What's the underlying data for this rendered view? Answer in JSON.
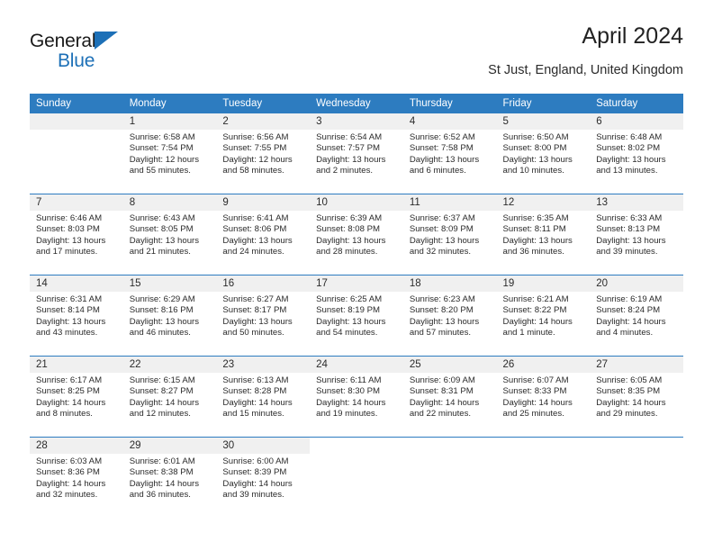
{
  "brand": {
    "name_part1": "General",
    "name_part2": "Blue",
    "triangle_color": "#1d70b7"
  },
  "header": {
    "title": "April 2024",
    "subtitle": "St Just, England, United Kingdom",
    "header_bg": "#2d7cc0",
    "daynum_bg": "#f0f0f0"
  },
  "weekdays": [
    "Sunday",
    "Monday",
    "Tuesday",
    "Wednesday",
    "Thursday",
    "Friday",
    "Saturday"
  ],
  "labels": {
    "sunrise_prefix": "Sunrise:",
    "sunset_prefix": "Sunset:",
    "daylight_prefix": "Daylight:"
  },
  "weeks": [
    [
      {
        "day": "",
        "l1": "",
        "l2": "",
        "l3": "",
        "l4": "",
        "empty": true
      },
      {
        "day": "1",
        "l1": "Sunrise: 6:58 AM",
        "l2": "Sunset: 7:54 PM",
        "l3": "Daylight: 12 hours",
        "l4": "and 55 minutes."
      },
      {
        "day": "2",
        "l1": "Sunrise: 6:56 AM",
        "l2": "Sunset: 7:55 PM",
        "l3": "Daylight: 12 hours",
        "l4": "and 58 minutes."
      },
      {
        "day": "3",
        "l1": "Sunrise: 6:54 AM",
        "l2": "Sunset: 7:57 PM",
        "l3": "Daylight: 13 hours",
        "l4": "and 2 minutes."
      },
      {
        "day": "4",
        "l1": "Sunrise: 6:52 AM",
        "l2": "Sunset: 7:58 PM",
        "l3": "Daylight: 13 hours",
        "l4": "and 6 minutes."
      },
      {
        "day": "5",
        "l1": "Sunrise: 6:50 AM",
        "l2": "Sunset: 8:00 PM",
        "l3": "Daylight: 13 hours",
        "l4": "and 10 minutes."
      },
      {
        "day": "6",
        "l1": "Sunrise: 6:48 AM",
        "l2": "Sunset: 8:02 PM",
        "l3": "Daylight: 13 hours",
        "l4": "and 13 minutes."
      }
    ],
    [
      {
        "day": "7",
        "l1": "Sunrise: 6:46 AM",
        "l2": "Sunset: 8:03 PM",
        "l3": "Daylight: 13 hours",
        "l4": "and 17 minutes."
      },
      {
        "day": "8",
        "l1": "Sunrise: 6:43 AM",
        "l2": "Sunset: 8:05 PM",
        "l3": "Daylight: 13 hours",
        "l4": "and 21 minutes."
      },
      {
        "day": "9",
        "l1": "Sunrise: 6:41 AM",
        "l2": "Sunset: 8:06 PM",
        "l3": "Daylight: 13 hours",
        "l4": "and 24 minutes."
      },
      {
        "day": "10",
        "l1": "Sunrise: 6:39 AM",
        "l2": "Sunset: 8:08 PM",
        "l3": "Daylight: 13 hours",
        "l4": "and 28 minutes."
      },
      {
        "day": "11",
        "l1": "Sunrise: 6:37 AM",
        "l2": "Sunset: 8:09 PM",
        "l3": "Daylight: 13 hours",
        "l4": "and 32 minutes."
      },
      {
        "day": "12",
        "l1": "Sunrise: 6:35 AM",
        "l2": "Sunset: 8:11 PM",
        "l3": "Daylight: 13 hours",
        "l4": "and 36 minutes."
      },
      {
        "day": "13",
        "l1": "Sunrise: 6:33 AM",
        "l2": "Sunset: 8:13 PM",
        "l3": "Daylight: 13 hours",
        "l4": "and 39 minutes."
      }
    ],
    [
      {
        "day": "14",
        "l1": "Sunrise: 6:31 AM",
        "l2": "Sunset: 8:14 PM",
        "l3": "Daylight: 13 hours",
        "l4": "and 43 minutes."
      },
      {
        "day": "15",
        "l1": "Sunrise: 6:29 AM",
        "l2": "Sunset: 8:16 PM",
        "l3": "Daylight: 13 hours",
        "l4": "and 46 minutes."
      },
      {
        "day": "16",
        "l1": "Sunrise: 6:27 AM",
        "l2": "Sunset: 8:17 PM",
        "l3": "Daylight: 13 hours",
        "l4": "and 50 minutes."
      },
      {
        "day": "17",
        "l1": "Sunrise: 6:25 AM",
        "l2": "Sunset: 8:19 PM",
        "l3": "Daylight: 13 hours",
        "l4": "and 54 minutes."
      },
      {
        "day": "18",
        "l1": "Sunrise: 6:23 AM",
        "l2": "Sunset: 8:20 PM",
        "l3": "Daylight: 13 hours",
        "l4": "and 57 minutes."
      },
      {
        "day": "19",
        "l1": "Sunrise: 6:21 AM",
        "l2": "Sunset: 8:22 PM",
        "l3": "Daylight: 14 hours",
        "l4": "and 1 minute."
      },
      {
        "day": "20",
        "l1": "Sunrise: 6:19 AM",
        "l2": "Sunset: 8:24 PM",
        "l3": "Daylight: 14 hours",
        "l4": "and 4 minutes."
      }
    ],
    [
      {
        "day": "21",
        "l1": "Sunrise: 6:17 AM",
        "l2": "Sunset: 8:25 PM",
        "l3": "Daylight: 14 hours",
        "l4": "and 8 minutes."
      },
      {
        "day": "22",
        "l1": "Sunrise: 6:15 AM",
        "l2": "Sunset: 8:27 PM",
        "l3": "Daylight: 14 hours",
        "l4": "and 12 minutes."
      },
      {
        "day": "23",
        "l1": "Sunrise: 6:13 AM",
        "l2": "Sunset: 8:28 PM",
        "l3": "Daylight: 14 hours",
        "l4": "and 15 minutes."
      },
      {
        "day": "24",
        "l1": "Sunrise: 6:11 AM",
        "l2": "Sunset: 8:30 PM",
        "l3": "Daylight: 14 hours",
        "l4": "and 19 minutes."
      },
      {
        "day": "25",
        "l1": "Sunrise: 6:09 AM",
        "l2": "Sunset: 8:31 PM",
        "l3": "Daylight: 14 hours",
        "l4": "and 22 minutes."
      },
      {
        "day": "26",
        "l1": "Sunrise: 6:07 AM",
        "l2": "Sunset: 8:33 PM",
        "l3": "Daylight: 14 hours",
        "l4": "and 25 minutes."
      },
      {
        "day": "27",
        "l1": "Sunrise: 6:05 AM",
        "l2": "Sunset: 8:35 PM",
        "l3": "Daylight: 14 hours",
        "l4": "and 29 minutes."
      }
    ],
    [
      {
        "day": "28",
        "l1": "Sunrise: 6:03 AM",
        "l2": "Sunset: 8:36 PM",
        "l3": "Daylight: 14 hours",
        "l4": "and 32 minutes."
      },
      {
        "day": "29",
        "l1": "Sunrise: 6:01 AM",
        "l2": "Sunset: 8:38 PM",
        "l3": "Daylight: 14 hours",
        "l4": "and 36 minutes."
      },
      {
        "day": "30",
        "l1": "Sunrise: 6:00 AM",
        "l2": "Sunset: 8:39 PM",
        "l3": "Daylight: 14 hours",
        "l4": "and 39 minutes."
      },
      {
        "day": "",
        "l1": "",
        "l2": "",
        "l3": "",
        "l4": "",
        "blank": true
      },
      {
        "day": "",
        "l1": "",
        "l2": "",
        "l3": "",
        "l4": "",
        "blank": true
      },
      {
        "day": "",
        "l1": "",
        "l2": "",
        "l3": "",
        "l4": "",
        "blank": true
      },
      {
        "day": "",
        "l1": "",
        "l2": "",
        "l3": "",
        "l4": "",
        "blank": true
      }
    ]
  ]
}
